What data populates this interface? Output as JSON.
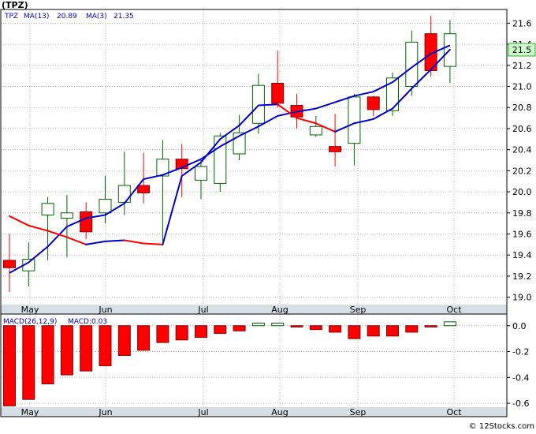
{
  "ticker_title": "(TPZ)",
  "price_legend": {
    "symbol": "TPZ",
    "ma13_label": "MA(13)",
    "ma13_value": "20.89",
    "ma3_label": "MA(3)",
    "ma3_value": "21.35",
    "last_price_tag": "21.5"
  },
  "macd_legend": {
    "label": "MACD(26,12,9)",
    "value_label": "MACD:0.03"
  },
  "watermark": "© 12Stocks.com",
  "colors": {
    "up": "#ffffff",
    "down": "#ff0000",
    "candle_border": "#006400",
    "ma13": "#0000cc",
    "ma3_up": "#0000cc",
    "ma3_down": "#ff0000",
    "grid": "#bbbbbb",
    "axis_band": "#d7dfe6",
    "tag_bg": "#ccffcc"
  },
  "chart_data": [
    {
      "type": "candlestick",
      "title": "(TPZ)",
      "x_tick_labels": [
        "May",
        "Jun",
        "Jul",
        "Aug",
        "Sep",
        "Oct"
      ],
      "y_tick_labels": [
        "19.0",
        "19.2",
        "19.4",
        "19.6",
        "19.8",
        "20.0",
        "20.2",
        "20.4",
        "20.6",
        "20.8",
        "21.0",
        "21.2",
        "21.4",
        "21.6"
      ],
      "ylim": [
        18.93,
        21.73
      ],
      "grid": true,
      "candles": [
        {
          "open": 19.35,
          "high": 19.6,
          "low": 19.05,
          "close": 19.28
        },
        {
          "open": 19.25,
          "high": 19.52,
          "low": 19.1,
          "close": 19.36
        },
        {
          "open": 19.78,
          "high": 19.95,
          "low": 19.35,
          "close": 19.89
        },
        {
          "open": 19.75,
          "high": 19.97,
          "low": 19.38,
          "close": 19.8
        },
        {
          "open": 19.81,
          "high": 19.9,
          "low": 19.55,
          "close": 19.62
        },
        {
          "open": 19.8,
          "high": 20.15,
          "low": 19.7,
          "close": 19.93
        },
        {
          "open": 19.9,
          "high": 20.38,
          "low": 19.78,
          "close": 20.06
        },
        {
          "open": 20.06,
          "high": 20.37,
          "low": 19.89,
          "close": 19.99
        },
        {
          "open": 20.15,
          "high": 20.49,
          "low": 19.53,
          "close": 20.31
        },
        {
          "open": 20.31,
          "high": 20.45,
          "low": 19.95,
          "close": 20.22
        },
        {
          "open": 20.11,
          "high": 20.3,
          "low": 19.93,
          "close": 20.24
        },
        {
          "open": 20.08,
          "high": 20.56,
          "low": 20.0,
          "close": 20.53
        },
        {
          "open": 20.36,
          "high": 20.73,
          "low": 20.3,
          "close": 20.56
        },
        {
          "open": 20.65,
          "high": 21.12,
          "low": 20.55,
          "close": 21.01
        },
        {
          "open": 21.03,
          "high": 21.34,
          "low": 20.8,
          "close": 20.84
        },
        {
          "open": 20.82,
          "high": 20.93,
          "low": 20.6,
          "close": 20.71
        },
        {
          "open": 20.54,
          "high": 20.72,
          "low": 20.52,
          "close": 20.62
        },
        {
          "open": 20.43,
          "high": 20.74,
          "low": 20.24,
          "close": 20.38
        },
        {
          "open": 20.46,
          "high": 20.93,
          "low": 20.25,
          "close": 20.9
        },
        {
          "open": 20.9,
          "high": 20.91,
          "low": 20.72,
          "close": 20.78
        },
        {
          "open": 20.77,
          "high": 21.13,
          "low": 20.72,
          "close": 21.08
        },
        {
          "open": 21.0,
          "high": 21.53,
          "low": 20.91,
          "close": 21.42
        },
        {
          "open": 21.5,
          "high": 21.67,
          "low": 21.09,
          "close": 21.15
        },
        {
          "open": 21.19,
          "high": 21.63,
          "low": 21.03,
          "close": 21.5
        }
      ],
      "series": [
        {
          "name": "MA(13)",
          "values": [
            19.23,
            19.33,
            19.48,
            19.67,
            19.75,
            19.78,
            19.89,
            20.12,
            20.16,
            20.23,
            20.31,
            20.43,
            20.53,
            20.62,
            20.72,
            20.76,
            20.79,
            20.85,
            20.91,
            20.95,
            21.04,
            21.18,
            21.31,
            21.39
          ]
        },
        {
          "name": "MA(3)",
          "values": [
            19.77,
            19.68,
            19.63,
            19.57,
            19.5,
            19.53,
            19.54,
            19.51,
            19.5,
            20.15,
            20.28,
            20.5,
            20.63,
            20.82,
            20.83,
            20.7,
            20.65,
            20.57,
            20.65,
            20.69,
            20.79,
            20.98,
            21.16,
            21.35
          ]
        }
      ]
    },
    {
      "type": "bar",
      "title": "MACD(26,12,9)",
      "x_tick_labels": [
        "May",
        "Jun",
        "Jul",
        "Aug",
        "Sep",
        "Oct"
      ],
      "y_tick_labels": [
        "0.0",
        "-0.2",
        "-0.4",
        "-0.6"
      ],
      "ylim": [
        -0.63,
        0.09
      ],
      "grid": true,
      "series": [
        {
          "name": "MACD",
          "values": [
            -0.62,
            -0.57,
            -0.45,
            -0.38,
            -0.35,
            -0.31,
            -0.23,
            -0.19,
            -0.13,
            -0.11,
            -0.09,
            -0.06,
            -0.04,
            0.02,
            0.02,
            -0.01,
            -0.03,
            -0.05,
            -0.1,
            -0.08,
            -0.08,
            -0.05,
            -0.01,
            0.03
          ]
        }
      ]
    }
  ]
}
